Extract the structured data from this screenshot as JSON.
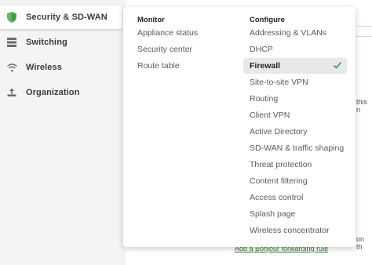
{
  "sidebar": {
    "items": [
      {
        "label": "Security & SD-WAN",
        "icon": "shield-icon",
        "active": true
      },
      {
        "label": "Switching",
        "icon": "switch-icon",
        "active": false
      },
      {
        "label": "Wireless",
        "icon": "wifi-icon",
        "active": false
      },
      {
        "label": "Organization",
        "icon": "organization-icon",
        "active": false
      }
    ]
  },
  "menu": {
    "monitor": {
      "heading": "Monitor",
      "items": [
        "Appliance status",
        "Security center",
        "Route table"
      ]
    },
    "configure": {
      "heading": "Configure",
      "items": [
        "Addressing & VLANs",
        "DHCP",
        "Firewall",
        "Site-to-site VPN",
        "Routing",
        "Client VPN",
        "Active Directory",
        "SD-WAN & traffic shaping",
        "Threat protection",
        "Content filtering",
        "Access control",
        "Splash page",
        "Wireless concentrator"
      ],
      "selected": "Firewall"
    }
  },
  "background": {
    "fragment_1": "this n",
    "fragment_2": "on th",
    "link": "Add a Bonjour forwarding rule"
  },
  "colors": {
    "shield": "#5cb85c",
    "check": "#3a9a3a",
    "link": "#2a7a2a"
  }
}
